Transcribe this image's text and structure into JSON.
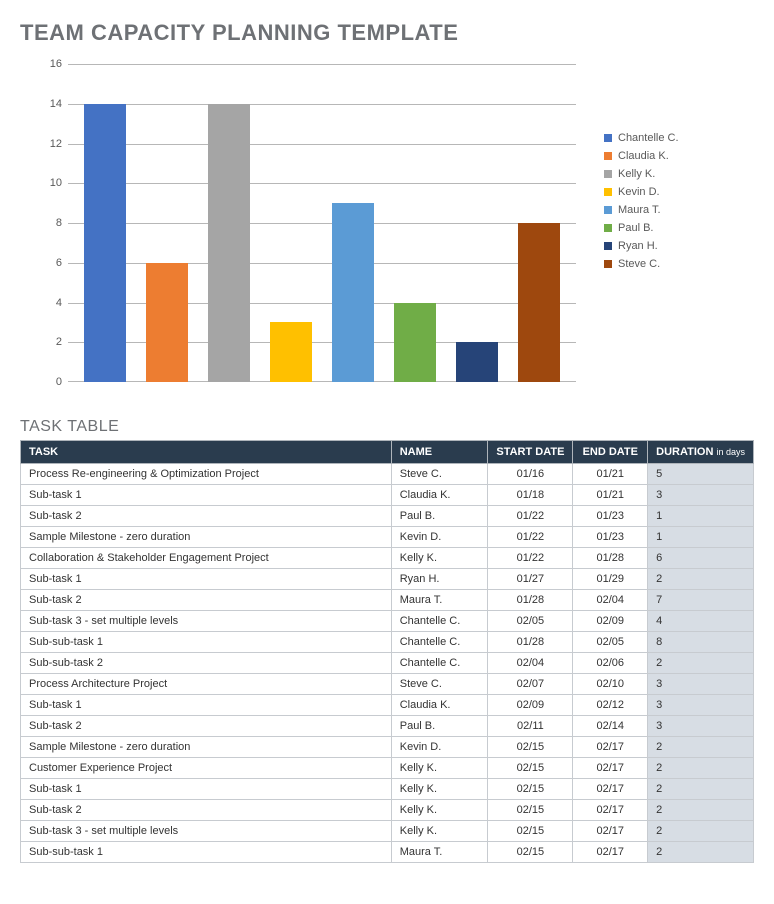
{
  "title": "TEAM CAPACITY PLANNING TEMPLATE",
  "task_table_heading": "TASK TABLE",
  "chart_data": {
    "type": "bar",
    "series": [
      {
        "name": "Chantelle C.",
        "value": 14,
        "color": "#4472c4"
      },
      {
        "name": "Claudia K.",
        "value": 6,
        "color": "#ed7d31"
      },
      {
        "name": "Kelly K.",
        "value": 14,
        "color": "#a5a5a5"
      },
      {
        "name": "Kevin D.",
        "value": 3,
        "color": "#ffc000"
      },
      {
        "name": "Maura T.",
        "value": 9,
        "color": "#5b9bd5"
      },
      {
        "name": "Paul B.",
        "value": 4,
        "color": "#70ad47"
      },
      {
        "name": "Ryan H.",
        "value": 2,
        "color": "#264478"
      },
      {
        "name": "Steve C.",
        "value": 8,
        "color": "#9e480e"
      }
    ],
    "y_ticks": [
      0,
      2,
      4,
      6,
      8,
      10,
      12,
      14,
      16
    ],
    "ylim": [
      0,
      16
    ],
    "title": "",
    "xlabel": "",
    "ylabel": ""
  },
  "table": {
    "headers": {
      "task": "TASK",
      "name": "NAME",
      "start": "START DATE",
      "end": "END DATE",
      "duration": "DURATION",
      "duration_unit": "in days"
    },
    "rows": [
      {
        "task": "Process Re-engineering & Optimization Project",
        "name": "Steve C.",
        "start": "01/16",
        "end": "01/21",
        "duration": "5"
      },
      {
        "task": "Sub-task 1",
        "name": "Claudia K.",
        "start": "01/18",
        "end": "01/21",
        "duration": "3"
      },
      {
        "task": "Sub-task 2",
        "name": "Paul B.",
        "start": "01/22",
        "end": "01/23",
        "duration": "1"
      },
      {
        "task": "Sample Milestone - zero duration",
        "name": "Kevin D.",
        "start": "01/22",
        "end": "01/23",
        "duration": "1"
      },
      {
        "task": "Collaboration & Stakeholder Engagement Project",
        "name": "Kelly K.",
        "start": "01/22",
        "end": "01/28",
        "duration": "6"
      },
      {
        "task": "Sub-task 1",
        "name": "Ryan H.",
        "start": "01/27",
        "end": "01/29",
        "duration": "2"
      },
      {
        "task": "Sub-task 2",
        "name": "Maura T.",
        "start": "01/28",
        "end": "02/04",
        "duration": "7"
      },
      {
        "task": "Sub-task 3 - set multiple levels",
        "name": "Chantelle C.",
        "start": "02/05",
        "end": "02/09",
        "duration": "4"
      },
      {
        "task": "Sub-sub-task 1",
        "name": "Chantelle C.",
        "start": "01/28",
        "end": "02/05",
        "duration": "8"
      },
      {
        "task": "Sub-sub-task 2",
        "name": "Chantelle C.",
        "start": "02/04",
        "end": "02/06",
        "duration": "2"
      },
      {
        "task": "Process Architecture Project",
        "name": "Steve C.",
        "start": "02/07",
        "end": "02/10",
        "duration": "3"
      },
      {
        "task": "Sub-task 1",
        "name": "Claudia K.",
        "start": "02/09",
        "end": "02/12",
        "duration": "3"
      },
      {
        "task": "Sub-task 2",
        "name": "Paul B.",
        "start": "02/11",
        "end": "02/14",
        "duration": "3"
      },
      {
        "task": "Sample Milestone - zero duration",
        "name": "Kevin D.",
        "start": "02/15",
        "end": "02/17",
        "duration": "2"
      },
      {
        "task": "Customer Experience Project",
        "name": "Kelly K.",
        "start": "02/15",
        "end": "02/17",
        "duration": "2"
      },
      {
        "task": "Sub-task 1",
        "name": "Kelly K.",
        "start": "02/15",
        "end": "02/17",
        "duration": "2"
      },
      {
        "task": "Sub-task 2",
        "name": "Kelly K.",
        "start": "02/15",
        "end": "02/17",
        "duration": "2"
      },
      {
        "task": "Sub-task 3 - set multiple levels",
        "name": "Kelly K.",
        "start": "02/15",
        "end": "02/17",
        "duration": "2"
      },
      {
        "task": "Sub-sub-task 1",
        "name": "Maura T.",
        "start": "02/15",
        "end": "02/17",
        "duration": "2"
      }
    ]
  }
}
